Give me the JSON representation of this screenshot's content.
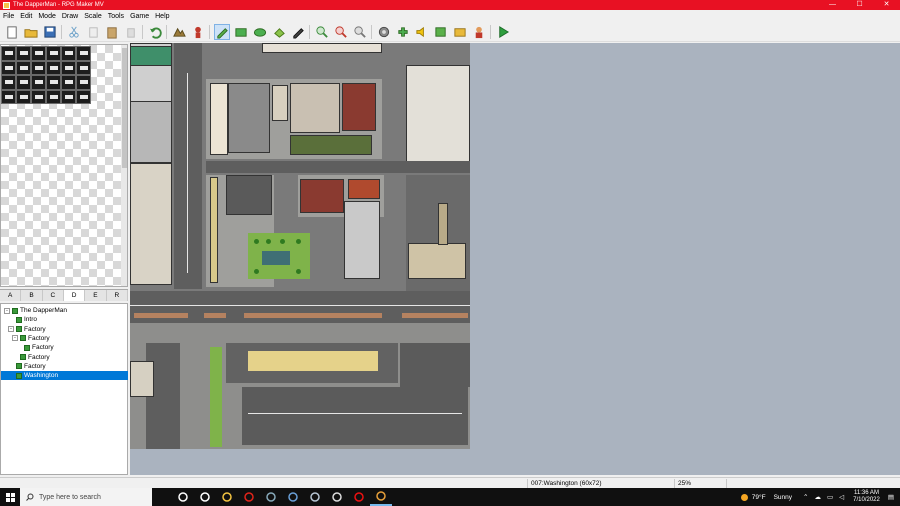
{
  "window": {
    "title": "The DapperMan - RPG Maker MV",
    "minimize": "—",
    "maximize": "☐",
    "close": "✕"
  },
  "menu": [
    "File",
    "Edit",
    "Mode",
    "Draw",
    "Scale",
    "Tools",
    "Game",
    "Help"
  ],
  "toolbar": [
    {
      "icon": "new-project-icon",
      "active": false
    },
    {
      "icon": "open-project-icon",
      "active": false
    },
    {
      "icon": "save-project-icon",
      "active": false
    },
    {
      "sep": true
    },
    {
      "icon": "cut-icon",
      "active": false
    },
    {
      "icon": "copy-icon",
      "active": false
    },
    {
      "icon": "paste-icon",
      "active": false
    },
    {
      "icon": "delete-icon",
      "active": false
    },
    {
      "sep": true
    },
    {
      "icon": "undo-icon",
      "active": false
    },
    {
      "sep": true
    },
    {
      "icon": "map-mode-icon",
      "active": false
    },
    {
      "icon": "event-mode-icon",
      "active": false
    },
    {
      "sep": true
    },
    {
      "icon": "pencil-icon",
      "active": true
    },
    {
      "icon": "rectangle-icon",
      "active": false
    },
    {
      "icon": "ellipse-icon",
      "active": false
    },
    {
      "icon": "fill-icon",
      "active": false
    },
    {
      "icon": "shadow-pen-icon",
      "active": false
    },
    {
      "sep": true
    },
    {
      "icon": "zoom-in-icon",
      "active": false
    },
    {
      "icon": "zoom-out-icon",
      "active": false
    },
    {
      "icon": "actual-size-icon",
      "active": false
    },
    {
      "sep": true
    },
    {
      "icon": "database-icon",
      "active": false
    },
    {
      "icon": "plugin-manager-icon",
      "active": false
    },
    {
      "icon": "sound-test-icon",
      "active": false
    },
    {
      "icon": "event-searcher-icon",
      "active": false
    },
    {
      "icon": "resource-manager-icon",
      "active": false
    },
    {
      "icon": "character-generator-icon",
      "active": false
    },
    {
      "sep": true
    },
    {
      "icon": "playtest-icon",
      "active": false
    }
  ],
  "tileset_tabs": [
    {
      "label": "A",
      "selected": false
    },
    {
      "label": "B",
      "selected": false
    },
    {
      "label": "C",
      "selected": false
    },
    {
      "label": "D",
      "selected": true
    },
    {
      "label": "E",
      "selected": false
    },
    {
      "label": "R",
      "selected": false
    }
  ],
  "map_tree": [
    {
      "label": "The DapperMan",
      "level": 0,
      "expander": "-",
      "selected": false
    },
    {
      "label": "Intro",
      "level": 1,
      "expander": "",
      "selected": false
    },
    {
      "label": "Factory",
      "level": 1,
      "expander": "-",
      "selected": false
    },
    {
      "label": "Factory",
      "level": 2,
      "expander": "-",
      "selected": false
    },
    {
      "label": "Factory",
      "level": 3,
      "expander": "",
      "selected": false
    },
    {
      "label": "Factory",
      "level": 2,
      "expander": "",
      "selected": false
    },
    {
      "label": "Factory",
      "level": 1,
      "expander": "",
      "selected": false
    },
    {
      "label": "Washington",
      "level": 1,
      "expander": "",
      "selected": true
    }
  ],
  "status": {
    "map_info": "007:Washington (60x72)",
    "zoom": "25%"
  },
  "taskbar": {
    "search_placeholder": "Type here to search",
    "apps": [
      {
        "icon": "cortana-icon",
        "running": false
      },
      {
        "icon": "task-view-icon",
        "running": false
      },
      {
        "icon": "file-explorer-icon",
        "running": false
      },
      {
        "icon": "opera-icon",
        "running": false
      },
      {
        "icon": "app-icon",
        "running": false
      },
      {
        "icon": "mail-icon",
        "running": false
      },
      {
        "icon": "steam-icon",
        "running": false
      },
      {
        "icon": "unity-icon",
        "running": false
      },
      {
        "icon": "record-icon",
        "running": false
      },
      {
        "icon": "rpg-maker-icon",
        "running": true
      }
    ],
    "weather": {
      "temp": "79°F",
      "condition": "Sunny"
    },
    "clock": {
      "time": "11:36 AM",
      "date": "7/10/2022"
    }
  },
  "colors": {
    "titlebar": "#e81123",
    "selection": "#0078d7",
    "map_background": "#aab3bf",
    "taskbar": "#101010"
  }
}
